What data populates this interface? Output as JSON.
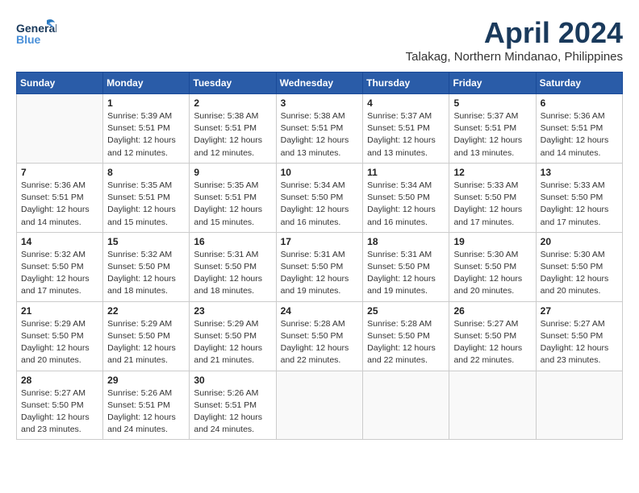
{
  "header": {
    "logo_general": "General",
    "logo_blue": "Blue",
    "month": "April 2024",
    "location": "Talakag, Northern Mindanao, Philippines"
  },
  "weekdays": [
    "Sunday",
    "Monday",
    "Tuesday",
    "Wednesday",
    "Thursday",
    "Friday",
    "Saturday"
  ],
  "weeks": [
    [
      {
        "day": "",
        "info": ""
      },
      {
        "day": "1",
        "info": "Sunrise: 5:39 AM\nSunset: 5:51 PM\nDaylight: 12 hours\nand 12 minutes."
      },
      {
        "day": "2",
        "info": "Sunrise: 5:38 AM\nSunset: 5:51 PM\nDaylight: 12 hours\nand 12 minutes."
      },
      {
        "day": "3",
        "info": "Sunrise: 5:38 AM\nSunset: 5:51 PM\nDaylight: 12 hours\nand 13 minutes."
      },
      {
        "day": "4",
        "info": "Sunrise: 5:37 AM\nSunset: 5:51 PM\nDaylight: 12 hours\nand 13 minutes."
      },
      {
        "day": "5",
        "info": "Sunrise: 5:37 AM\nSunset: 5:51 PM\nDaylight: 12 hours\nand 13 minutes."
      },
      {
        "day": "6",
        "info": "Sunrise: 5:36 AM\nSunset: 5:51 PM\nDaylight: 12 hours\nand 14 minutes."
      }
    ],
    [
      {
        "day": "7",
        "info": "Sunrise: 5:36 AM\nSunset: 5:51 PM\nDaylight: 12 hours\nand 14 minutes."
      },
      {
        "day": "8",
        "info": "Sunrise: 5:35 AM\nSunset: 5:51 PM\nDaylight: 12 hours\nand 15 minutes."
      },
      {
        "day": "9",
        "info": "Sunrise: 5:35 AM\nSunset: 5:51 PM\nDaylight: 12 hours\nand 15 minutes."
      },
      {
        "day": "10",
        "info": "Sunrise: 5:34 AM\nSunset: 5:50 PM\nDaylight: 12 hours\nand 16 minutes."
      },
      {
        "day": "11",
        "info": "Sunrise: 5:34 AM\nSunset: 5:50 PM\nDaylight: 12 hours\nand 16 minutes."
      },
      {
        "day": "12",
        "info": "Sunrise: 5:33 AM\nSunset: 5:50 PM\nDaylight: 12 hours\nand 17 minutes."
      },
      {
        "day": "13",
        "info": "Sunrise: 5:33 AM\nSunset: 5:50 PM\nDaylight: 12 hours\nand 17 minutes."
      }
    ],
    [
      {
        "day": "14",
        "info": "Sunrise: 5:32 AM\nSunset: 5:50 PM\nDaylight: 12 hours\nand 17 minutes."
      },
      {
        "day": "15",
        "info": "Sunrise: 5:32 AM\nSunset: 5:50 PM\nDaylight: 12 hours\nand 18 minutes."
      },
      {
        "day": "16",
        "info": "Sunrise: 5:31 AM\nSunset: 5:50 PM\nDaylight: 12 hours\nand 18 minutes."
      },
      {
        "day": "17",
        "info": "Sunrise: 5:31 AM\nSunset: 5:50 PM\nDaylight: 12 hours\nand 19 minutes."
      },
      {
        "day": "18",
        "info": "Sunrise: 5:31 AM\nSunset: 5:50 PM\nDaylight: 12 hours\nand 19 minutes."
      },
      {
        "day": "19",
        "info": "Sunrise: 5:30 AM\nSunset: 5:50 PM\nDaylight: 12 hours\nand 20 minutes."
      },
      {
        "day": "20",
        "info": "Sunrise: 5:30 AM\nSunset: 5:50 PM\nDaylight: 12 hours\nand 20 minutes."
      }
    ],
    [
      {
        "day": "21",
        "info": "Sunrise: 5:29 AM\nSunset: 5:50 PM\nDaylight: 12 hours\nand 20 minutes."
      },
      {
        "day": "22",
        "info": "Sunrise: 5:29 AM\nSunset: 5:50 PM\nDaylight: 12 hours\nand 21 minutes."
      },
      {
        "day": "23",
        "info": "Sunrise: 5:29 AM\nSunset: 5:50 PM\nDaylight: 12 hours\nand 21 minutes."
      },
      {
        "day": "24",
        "info": "Sunrise: 5:28 AM\nSunset: 5:50 PM\nDaylight: 12 hours\nand 22 minutes."
      },
      {
        "day": "25",
        "info": "Sunrise: 5:28 AM\nSunset: 5:50 PM\nDaylight: 12 hours\nand 22 minutes."
      },
      {
        "day": "26",
        "info": "Sunrise: 5:27 AM\nSunset: 5:50 PM\nDaylight: 12 hours\nand 22 minutes."
      },
      {
        "day": "27",
        "info": "Sunrise: 5:27 AM\nSunset: 5:50 PM\nDaylight: 12 hours\nand 23 minutes."
      }
    ],
    [
      {
        "day": "28",
        "info": "Sunrise: 5:27 AM\nSunset: 5:50 PM\nDaylight: 12 hours\nand 23 minutes."
      },
      {
        "day": "29",
        "info": "Sunrise: 5:26 AM\nSunset: 5:51 PM\nDaylight: 12 hours\nand 24 minutes."
      },
      {
        "day": "30",
        "info": "Sunrise: 5:26 AM\nSunset: 5:51 PM\nDaylight: 12 hours\nand 24 minutes."
      },
      {
        "day": "",
        "info": ""
      },
      {
        "day": "",
        "info": ""
      },
      {
        "day": "",
        "info": ""
      },
      {
        "day": "",
        "info": ""
      }
    ]
  ]
}
